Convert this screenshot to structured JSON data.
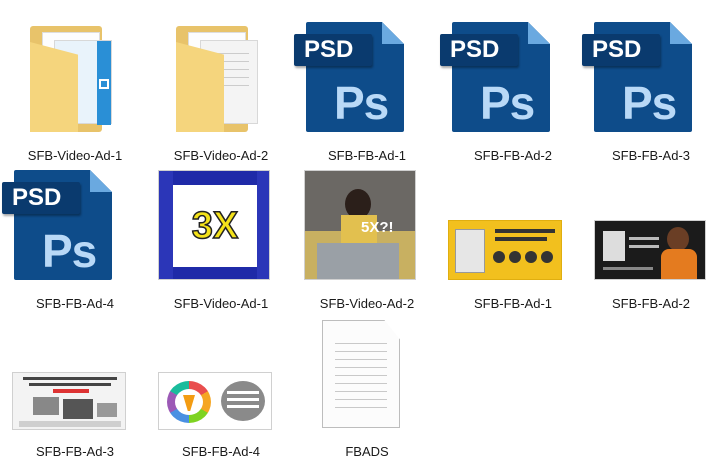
{
  "files": [
    {
      "label": "SFB-Video-Ad-1",
      "kind": "folder-video"
    },
    {
      "label": "SFB-Video-Ad-2",
      "kind": "folder-docs"
    },
    {
      "label": "SFB-FB-Ad-1",
      "kind": "psd"
    },
    {
      "label": "SFB-FB-Ad-2",
      "kind": "psd"
    },
    {
      "label": "SFB-FB-Ad-3",
      "kind": "psd"
    },
    {
      "label": "SFB-FB-Ad-4",
      "kind": "psd"
    },
    {
      "label": "SFB-Video-Ad-1",
      "kind": "image-3x"
    },
    {
      "label": "SFB-Video-Ad-2",
      "kind": "image-5x"
    },
    {
      "label": "SFB-FB-Ad-1",
      "kind": "image-banner-yellow"
    },
    {
      "label": "SFB-FB-Ad-2",
      "kind": "image-banner-dark"
    },
    {
      "label": "SFB-FB-Ad-3",
      "kind": "image-banner-light"
    },
    {
      "label": "SFB-FB-Ad-4",
      "kind": "image-banner-funnel"
    },
    {
      "label": "FBADS",
      "kind": "text-document"
    }
  ],
  "icons": {
    "psd_tag": "PSD",
    "psd_mark": "Ps",
    "thumb_3x": "3X",
    "thumb_5x": "5X?!"
  },
  "colors": {
    "psd_blue": "#0e4c8a",
    "folder_yellow": "#f5d57d",
    "banner_yellow": "#f2c01e"
  }
}
